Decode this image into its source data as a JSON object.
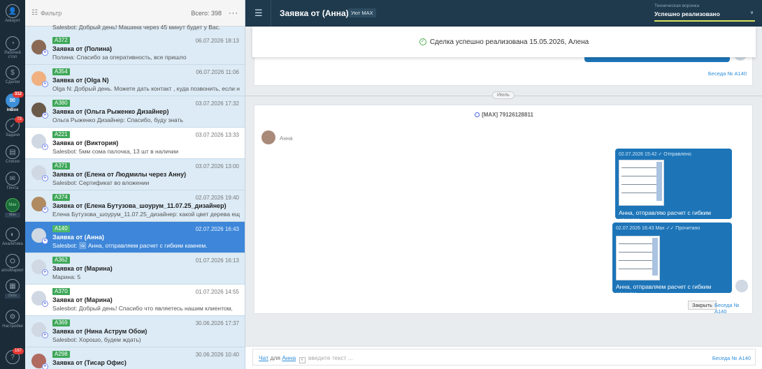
{
  "rail": [
    {
      "name": "account",
      "label": "Аккаунт",
      "icon": "👤"
    },
    {
      "name": "desktop",
      "label": "Рабочий стол",
      "icon": "◔"
    },
    {
      "name": "deals",
      "label": "Сделки",
      "icon": "$"
    },
    {
      "name": "inbox",
      "label": "inBox",
      "icon": "✉",
      "badge": "312"
    },
    {
      "name": "tasks",
      "label": "Задачи",
      "icon": "✓",
      "badge": "73"
    },
    {
      "name": "lists",
      "label": "Списки",
      "icon": "▤"
    },
    {
      "name": "mail",
      "label": "Почта",
      "icon": "✉"
    },
    {
      "name": "max",
      "label": "Max",
      "icon": "Max"
    },
    {
      "name": "analytics",
      "label": "Аналитика",
      "icon": "◐"
    },
    {
      "name": "amo-market",
      "label": "amoМаркет",
      "icon": "⛭"
    },
    {
      "name": "docs",
      "label": "Docs",
      "icon": "▦"
    },
    {
      "name": "settings",
      "label": "Настройки",
      "icon": "⚙"
    },
    {
      "name": "help",
      "label": "",
      "icon": "?",
      "badge": "167"
    }
  ],
  "list_header": {
    "filter": "Фильтр",
    "total": "Всего: 398",
    "more": "···"
  },
  "leads_partial_top": "Salesbot: Добрый день! Машина через 45 минут будет у Вас.",
  "leads": [
    {
      "tag": "A372",
      "date": "06.07.2026 18:13",
      "title": "Заявка от (Полина)",
      "msg": "Полина: Спасибо за оперативность, все пришло",
      "white": false,
      "selected": false,
      "av": "#8a6a55"
    },
    {
      "tag": "A354",
      "date": "06.07.2026 11:06",
      "title": "Заявка от (Olga N)",
      "msg": "Olga N: Добрый день. Можете дать контакт , куда позвонить, если не",
      "white": false,
      "selected": false,
      "av": "#f0b080"
    },
    {
      "tag": "A380",
      "date": "03.07.2026 17:32",
      "title": "Заявка от (Ольга Рыженко Дизайнер)",
      "msg": "Ольга Рыженко Дизайнер: Спасибо, буду знать",
      "white": false,
      "selected": false,
      "av": "#6a5a4a"
    },
    {
      "tag": "A221",
      "date": "03.07.2026 13:33",
      "title": "Заявка от (Виктория)",
      "msg": "Salesbot: 5мм сома палочка, 13 шт в наличии",
      "white": true,
      "selected": false,
      "av": "#cfd8e3"
    },
    {
      "tag": "A371",
      "date": "03.07.2026 13:00",
      "title": "Заявка от (Елена от Людмилы через Анну)",
      "msg": "Salesbot: Сертификат во вложении",
      "white": false,
      "selected": false,
      "av": "#cfd8e3"
    },
    {
      "tag": "A374",
      "date": "02.07.2026 19:40",
      "title": "Заявка от (Елена Бутузова_шоурум_11.07.25_дизайнер)",
      "msg": "Елена Бутузова_шоурум_11.07.25_дизайнер: какой цвет дерева еще",
      "white": false,
      "selected": false,
      "av": "#b08a60"
    },
    {
      "tag": "A140",
      "date": "02.07.2026 16:43",
      "title": "Заявка от (Анна)",
      "msg": "Salesbot: 🖼 Анна, отправляем расчет с гибким камнем.",
      "white": false,
      "selected": true,
      "av": "#cfd8e3"
    },
    {
      "tag": "A362",
      "date": "01.07.2026 16:13",
      "title": "Заявка от (Марина)",
      "msg": "Марина: 5",
      "white": false,
      "selected": false,
      "av": "#cfd8e3"
    },
    {
      "tag": "A370",
      "date": "01.07.2026 14:55",
      "title": "Заявка от (Марина)",
      "msg": "Salesbot: Добрый день! Спасибо что являетесь нашим клиентом,",
      "white": true,
      "selected": false,
      "av": "#cfd8e3"
    },
    {
      "tag": "A369",
      "date": "30.06.2026 17:37",
      "title": "Заявка от (Нина Аструм Обои)",
      "msg": "Salesbot: Хорошо, будем ждать)",
      "white": false,
      "selected": false,
      "av": "#cfd8e3"
    },
    {
      "tag": "A298",
      "date": "30.06.2026 10:40",
      "title": "Заявка от (Тисар Офис)",
      "msg": "",
      "white": false,
      "selected": false,
      "av": "#b06a60"
    }
  ],
  "topbar": {
    "title": "Заявка от (Анна)",
    "source": "Уют MAX",
    "pipeline": "Техническая воронка",
    "stage": "Успешно реализовано"
  },
  "feed": {
    "notice": "Сделка успешно реализована 15.05.2026, Алена",
    "conv_link_top": "Беседа № A140",
    "month": "Июль",
    "conv_head": "[MAX] 79126128811",
    "contact_name": "Анна",
    "msg1": {
      "meta": "02.07.2026 15:42 ✓ Отправлено",
      "text": "Анна, отправляю расчет с гибким камнем."
    },
    "msg2": {
      "meta": "02.07.2026 16:43 Max ✓✓ Прочитано",
      "text": "Анна, отправляем расчет с гибким камнем."
    },
    "close": "Закрыть",
    "conv_link": "Беседа № A140"
  },
  "input": {
    "chat": "Чат",
    "for": "для",
    "who": "Анна",
    "placeholder": "введите текст ...",
    "conv": "Беседа № A140"
  }
}
